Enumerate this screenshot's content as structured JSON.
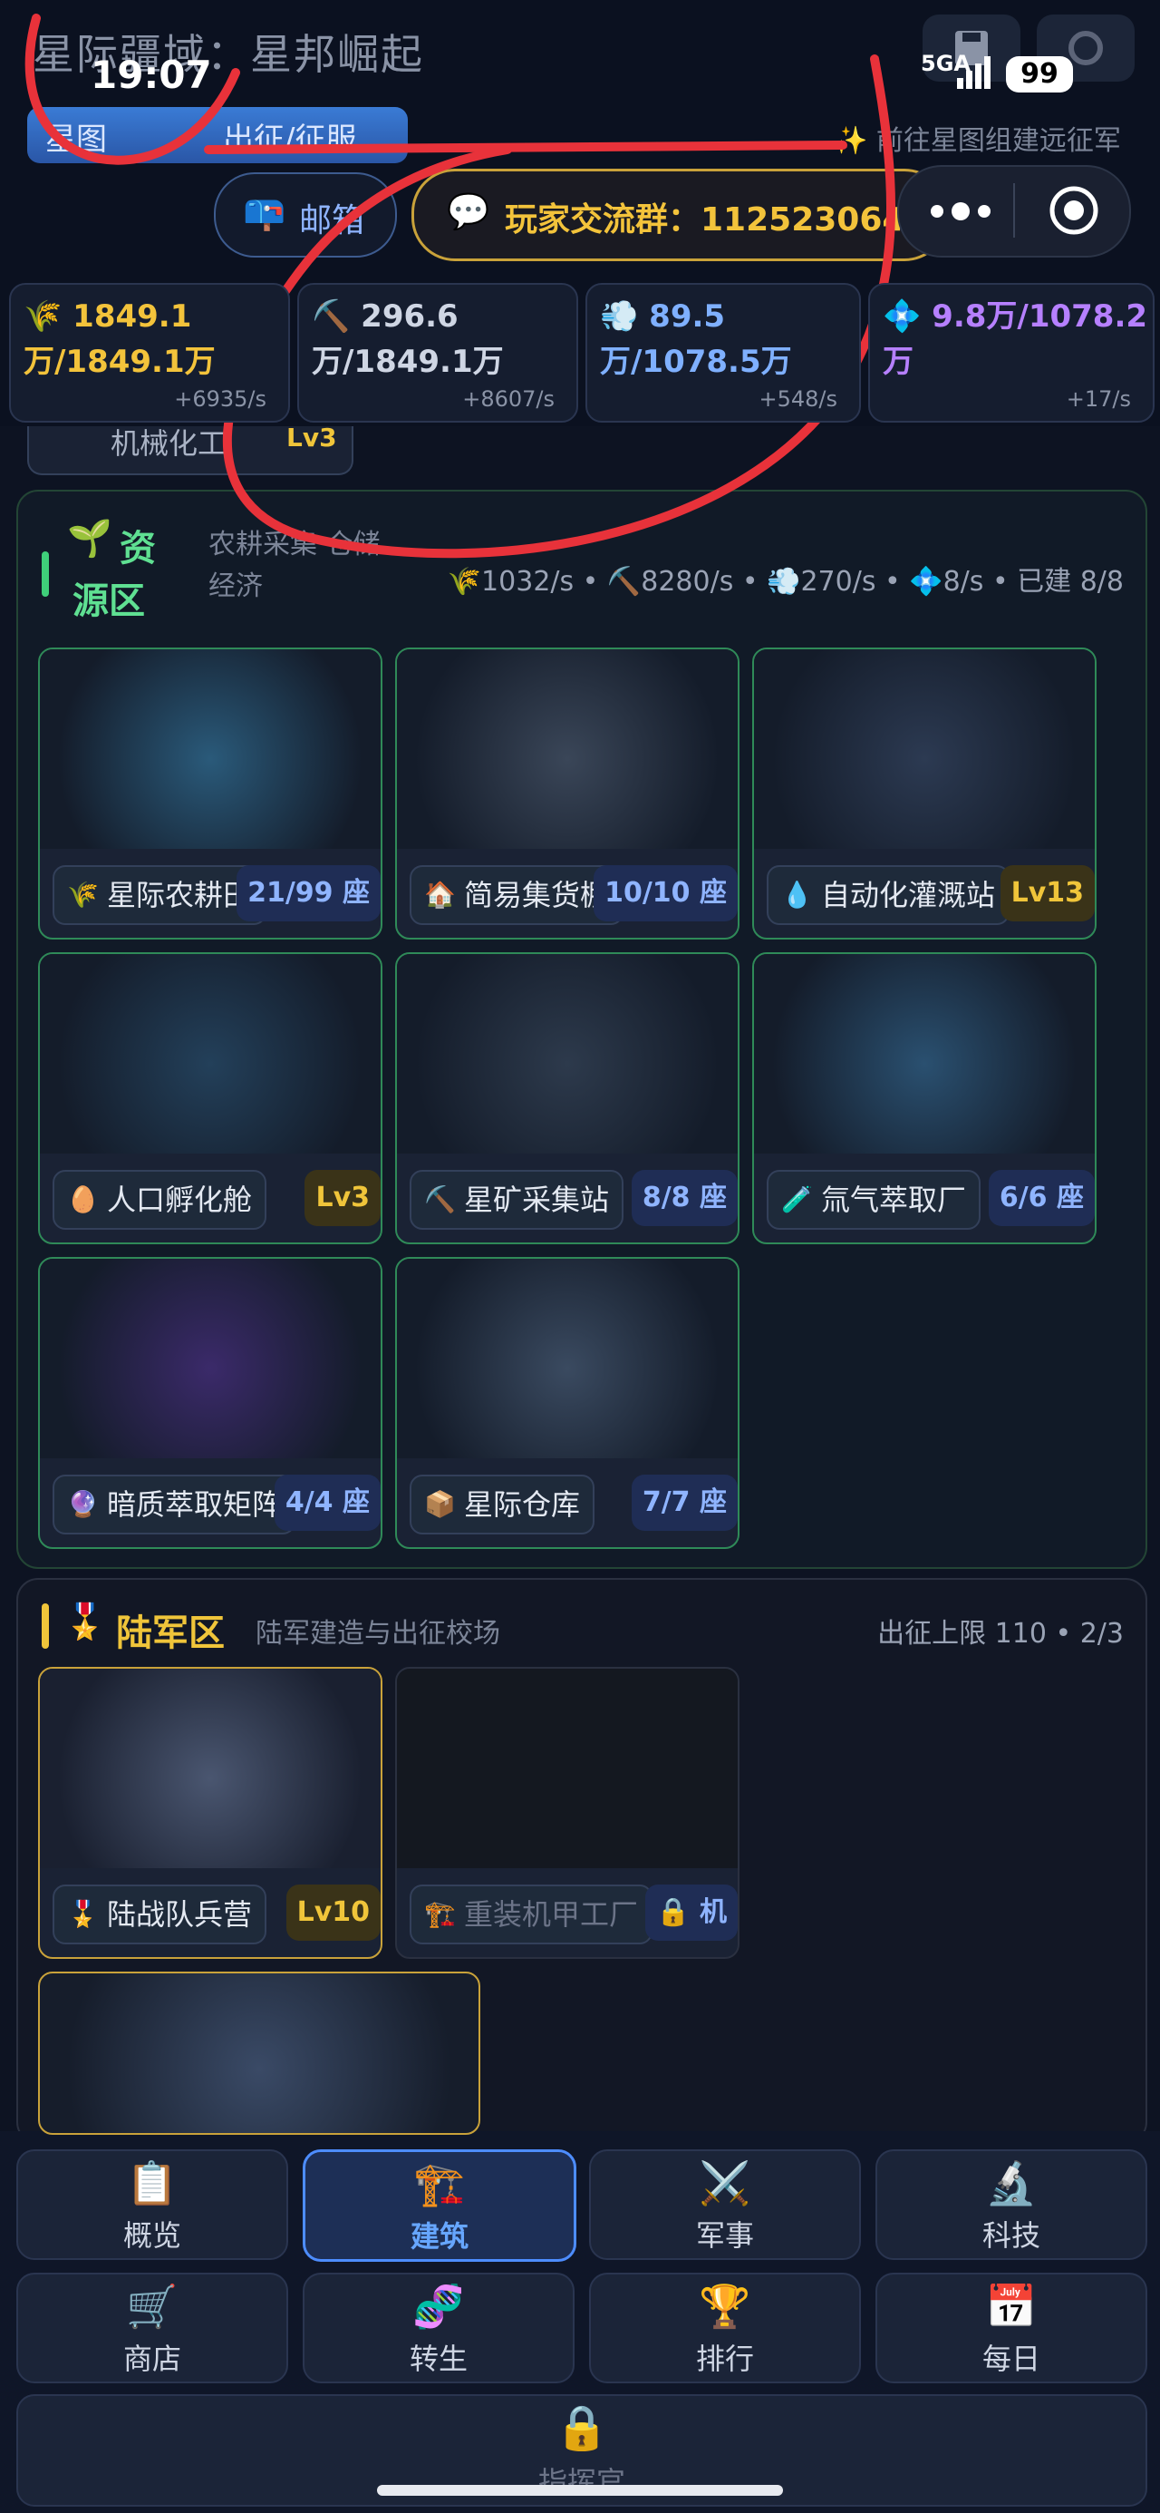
{
  "header": {
    "app_title": "星际疆域：星邦崛起",
    "clock": "19:07",
    "network": "5GA",
    "battery": "99",
    "tabs": [
      "星图",
      "出征/征服"
    ],
    "hint": "✨ 前往星图组建远征军",
    "mail_label": "邮箱",
    "group_label": "玩家交流群：112523064"
  },
  "resources": [
    {
      "name": "food",
      "icon": "🌾",
      "value": "1849.1万/1849.1万",
      "rate": "+6935/s",
      "color": "#f3c33b"
    },
    {
      "name": "ore",
      "icon": "⛏️",
      "value": "296.6万/1849.1万",
      "rate": "+8607/s",
      "color": "#cfd6e4"
    },
    {
      "name": "gas",
      "icon": "💨",
      "value": "89.5万/1078.5万",
      "rate": "+548/s",
      "color": "#7fb0ff"
    },
    {
      "name": "crystal",
      "icon": "💠",
      "value": "9.8万/1078.2万",
      "rate": "+17/s",
      "color": "#b680ff"
    }
  ],
  "partial_card": {
    "name": "机械化工",
    "level": "Lv3"
  },
  "resource_zone": {
    "title_line1": "资",
    "title_line2": "源区",
    "subtitle": "农耕采集 仓储经济",
    "stats": "🌾1032/s • ⛏️8280/s • 💨270/s • 💠8/s • 已建 8/8",
    "buildings": [
      {
        "name": "星际农耕田",
        "icon": "🌾",
        "badge": "21/99 座"
      },
      {
        "name": "简易集货棚",
        "icon": "🏠",
        "badge": "10/10 座"
      },
      {
        "name": "自动化灌溉站",
        "icon": "💧",
        "badge": "Lv13"
      },
      {
        "name": "人口孵化舱",
        "icon": "🥚",
        "badge": "Lv3"
      },
      {
        "name": "星矿采集站",
        "icon": "⛏️",
        "badge": "8/8 座"
      },
      {
        "name": "氚气萃取厂",
        "icon": "🧪",
        "badge": "6/6 座"
      },
      {
        "name": "暗质萃取矩阵",
        "icon": "🔮",
        "badge": "4/4 座"
      },
      {
        "name": "星际仓库",
        "icon": "📦",
        "badge": "7/7 座"
      }
    ]
  },
  "army_zone": {
    "title": "陆军区",
    "subtitle": "陆军建造与出征校场",
    "stats": "出征上限 110 • 2/3",
    "buildings": [
      {
        "name": "陆战队兵营",
        "icon": "🎖️",
        "badge": "Lv10"
      },
      {
        "name": "重装机甲工厂",
        "icon": "🏗️",
        "badge": "🔒 机"
      }
    ]
  },
  "nav": [
    {
      "label": "概览",
      "icon": "📋"
    },
    {
      "label": "建筑",
      "icon": "🏗️"
    },
    {
      "label": "军事",
      "icon": "⚔️"
    },
    {
      "label": "科技",
      "icon": "🔬"
    },
    {
      "label": "商店",
      "icon": "🛒"
    },
    {
      "label": "转生",
      "icon": "🧬"
    },
    {
      "label": "排行",
      "icon": "🏆"
    },
    {
      "label": "每日",
      "icon": "📅"
    }
  ],
  "commander": {
    "label": "指挥官",
    "icon": "🔒"
  }
}
